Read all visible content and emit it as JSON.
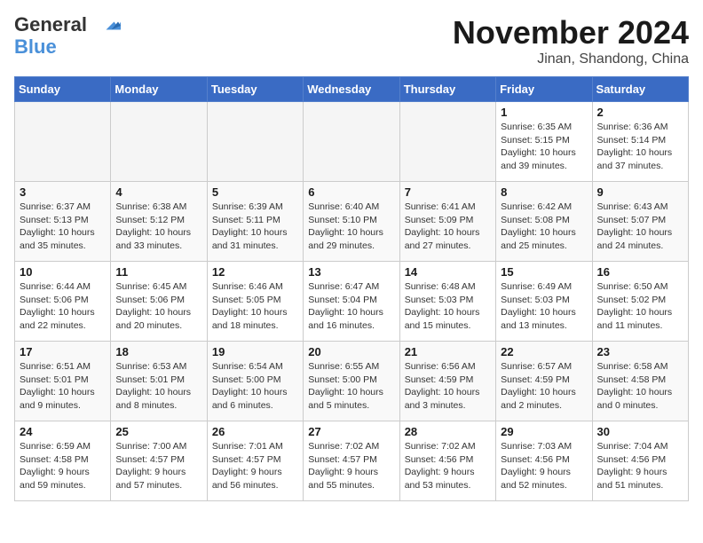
{
  "logo": {
    "line1": "General",
    "line2": "Blue"
  },
  "title": "November 2024",
  "location": "Jinan, Shandong, China",
  "days_of_week": [
    "Sunday",
    "Monday",
    "Tuesday",
    "Wednesday",
    "Thursday",
    "Friday",
    "Saturday"
  ],
  "weeks": [
    [
      {
        "day": "",
        "empty": true
      },
      {
        "day": "",
        "empty": true
      },
      {
        "day": "",
        "empty": true
      },
      {
        "day": "",
        "empty": true
      },
      {
        "day": "",
        "empty": true
      },
      {
        "day": "1",
        "sunrise": "6:35 AM",
        "sunset": "5:15 PM",
        "daylight": "10 hours and 39 minutes."
      },
      {
        "day": "2",
        "sunrise": "6:36 AM",
        "sunset": "5:14 PM",
        "daylight": "10 hours and 37 minutes."
      }
    ],
    [
      {
        "day": "3",
        "sunrise": "6:37 AM",
        "sunset": "5:13 PM",
        "daylight": "10 hours and 35 minutes."
      },
      {
        "day": "4",
        "sunrise": "6:38 AM",
        "sunset": "5:12 PM",
        "daylight": "10 hours and 33 minutes."
      },
      {
        "day": "5",
        "sunrise": "6:39 AM",
        "sunset": "5:11 PM",
        "daylight": "10 hours and 31 minutes."
      },
      {
        "day": "6",
        "sunrise": "6:40 AM",
        "sunset": "5:10 PM",
        "daylight": "10 hours and 29 minutes."
      },
      {
        "day": "7",
        "sunrise": "6:41 AM",
        "sunset": "5:09 PM",
        "daylight": "10 hours and 27 minutes."
      },
      {
        "day": "8",
        "sunrise": "6:42 AM",
        "sunset": "5:08 PM",
        "daylight": "10 hours and 25 minutes."
      },
      {
        "day": "9",
        "sunrise": "6:43 AM",
        "sunset": "5:07 PM",
        "daylight": "10 hours and 24 minutes."
      }
    ],
    [
      {
        "day": "10",
        "sunrise": "6:44 AM",
        "sunset": "5:06 PM",
        "daylight": "10 hours and 22 minutes."
      },
      {
        "day": "11",
        "sunrise": "6:45 AM",
        "sunset": "5:06 PM",
        "daylight": "10 hours and 20 minutes."
      },
      {
        "day": "12",
        "sunrise": "6:46 AM",
        "sunset": "5:05 PM",
        "daylight": "10 hours and 18 minutes."
      },
      {
        "day": "13",
        "sunrise": "6:47 AM",
        "sunset": "5:04 PM",
        "daylight": "10 hours and 16 minutes."
      },
      {
        "day": "14",
        "sunrise": "6:48 AM",
        "sunset": "5:03 PM",
        "daylight": "10 hours and 15 minutes."
      },
      {
        "day": "15",
        "sunrise": "6:49 AM",
        "sunset": "5:03 PM",
        "daylight": "10 hours and 13 minutes."
      },
      {
        "day": "16",
        "sunrise": "6:50 AM",
        "sunset": "5:02 PM",
        "daylight": "10 hours and 11 minutes."
      }
    ],
    [
      {
        "day": "17",
        "sunrise": "6:51 AM",
        "sunset": "5:01 PM",
        "daylight": "10 hours and 9 minutes."
      },
      {
        "day": "18",
        "sunrise": "6:53 AM",
        "sunset": "5:01 PM",
        "daylight": "10 hours and 8 minutes."
      },
      {
        "day": "19",
        "sunrise": "6:54 AM",
        "sunset": "5:00 PM",
        "daylight": "10 hours and 6 minutes."
      },
      {
        "day": "20",
        "sunrise": "6:55 AM",
        "sunset": "5:00 PM",
        "daylight": "10 hours and 5 minutes."
      },
      {
        "day": "21",
        "sunrise": "6:56 AM",
        "sunset": "4:59 PM",
        "daylight": "10 hours and 3 minutes."
      },
      {
        "day": "22",
        "sunrise": "6:57 AM",
        "sunset": "4:59 PM",
        "daylight": "10 hours and 2 minutes."
      },
      {
        "day": "23",
        "sunrise": "6:58 AM",
        "sunset": "4:58 PM",
        "daylight": "10 hours and 0 minutes."
      }
    ],
    [
      {
        "day": "24",
        "sunrise": "6:59 AM",
        "sunset": "4:58 PM",
        "daylight": "9 hours and 59 minutes."
      },
      {
        "day": "25",
        "sunrise": "7:00 AM",
        "sunset": "4:57 PM",
        "daylight": "9 hours and 57 minutes."
      },
      {
        "day": "26",
        "sunrise": "7:01 AM",
        "sunset": "4:57 PM",
        "daylight": "9 hours and 56 minutes."
      },
      {
        "day": "27",
        "sunrise": "7:02 AM",
        "sunset": "4:57 PM",
        "daylight": "9 hours and 55 minutes."
      },
      {
        "day": "28",
        "sunrise": "7:02 AM",
        "sunset": "4:56 PM",
        "daylight": "9 hours and 53 minutes."
      },
      {
        "day": "29",
        "sunrise": "7:03 AM",
        "sunset": "4:56 PM",
        "daylight": "9 hours and 52 minutes."
      },
      {
        "day": "30",
        "sunrise": "7:04 AM",
        "sunset": "4:56 PM",
        "daylight": "9 hours and 51 minutes."
      }
    ]
  ]
}
